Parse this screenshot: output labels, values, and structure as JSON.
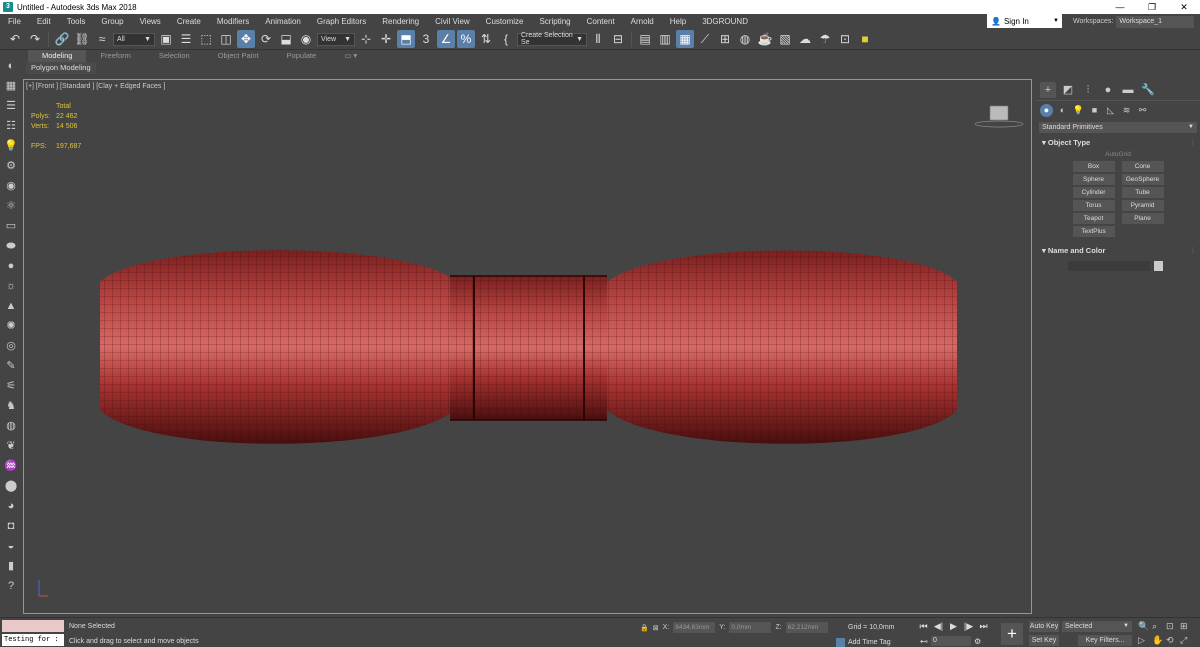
{
  "window": {
    "title": "Untitled - Autodesk 3ds Max 2018",
    "app_icon": "3ds-max-icon",
    "controls": [
      "—",
      "❐",
      "✕"
    ]
  },
  "menu": {
    "items": [
      "File",
      "Edit",
      "Tools",
      "Group",
      "Views",
      "Create",
      "Modifiers",
      "Animation",
      "Graph Editors",
      "Rendering",
      "Civil View",
      "Customize",
      "Scripting",
      "Content",
      "Arnold",
      "Help",
      "3DGROUND"
    ],
    "sign_in": "Sign In",
    "workspaces_label": "Workspaces:",
    "workspace": "Workspace_1"
  },
  "toolbar": {
    "selection_filter": "All",
    "reference_coord": "View",
    "named_selection": "Create Selection Se"
  },
  "ribbon": {
    "tabs": [
      "Modeling",
      "Freeform",
      "Selection",
      "Object Paint",
      "Populate"
    ],
    "active_tab": "Modeling",
    "subpanel": "Polygon Modeling"
  },
  "viewport": {
    "label": "[+] [Front ] [Standard ] [Clay + Edged Faces ]",
    "stats_header": "Total",
    "stats": [
      {
        "key": "Polys:",
        "value": "22 462"
      },
      {
        "key": "Verts:",
        "value": "14 506"
      }
    ],
    "fps_key": "FPS:",
    "fps_value": "197,687",
    "mesh_color": "#a8302e"
  },
  "command_panel": {
    "category": "Standard Primitives",
    "object_type_title": "Object Type",
    "autogrid": "AutoGrid",
    "buttons": [
      "Box",
      "Cone",
      "Sphere",
      "GeoSphere",
      "Cylinder",
      "Tube",
      "Torus",
      "Pyramid",
      "Teapot",
      "Plane",
      "TextPlus"
    ],
    "name_color_title": "Name and Color"
  },
  "statusbar": {
    "script_input": "Testing for :",
    "selection": "None Selected",
    "prompt": "Click and drag to select and move objects",
    "x_label": "X:",
    "x_value": "8434,63mm",
    "y_label": "Y:",
    "y_value": "0,0mm",
    "z_label": "Z:",
    "z_value": "62,212mm",
    "grid": "Grid = 10,0mm",
    "add_time_tag": "Add Time Tag",
    "frame": "0",
    "auto_key": "Auto Key",
    "set_key": "Set Key",
    "selected_filter": "Selected",
    "key_filters": "Key Filters..."
  },
  "colors": {
    "accent": "#5a7fa8",
    "viewport_border": "#b59a2c",
    "stats_text": "#e0c437"
  }
}
